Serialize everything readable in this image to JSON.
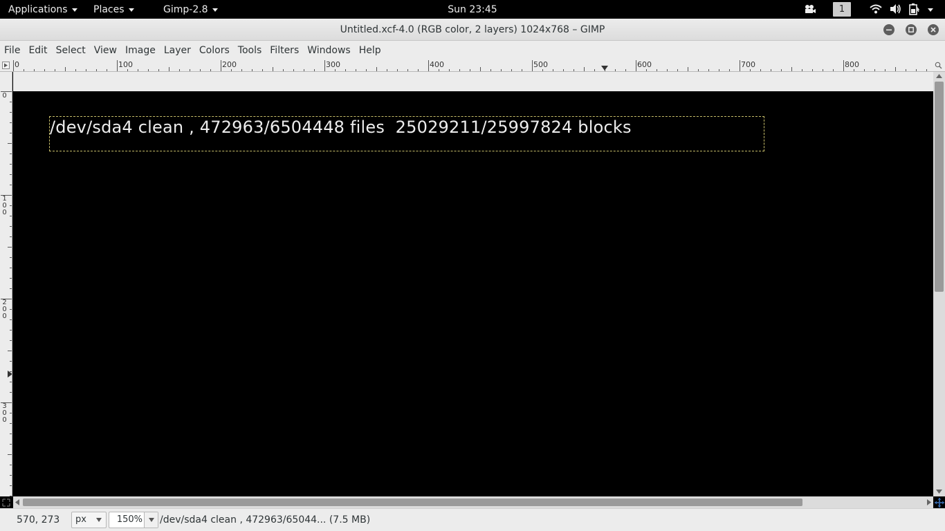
{
  "topbar": {
    "applications": "Applications",
    "places": "Places",
    "app_menu": "Gimp-2.8",
    "clock": "Sun 23:45",
    "workspace": "1"
  },
  "window": {
    "title": "Untitled.xcf-4.0 (RGB color, 2 layers) 1024x768 – GIMP"
  },
  "menubar": {
    "items": [
      "File",
      "Edit",
      "Select",
      "View",
      "Image",
      "Layer",
      "Colors",
      "Tools",
      "Filters",
      "Windows",
      "Help"
    ]
  },
  "rulers": {
    "horizontal": [
      "0",
      "100",
      "200",
      "300",
      "400",
      "500",
      "600",
      "700",
      "800"
    ],
    "vertical": [
      "0",
      "100",
      "200",
      "300"
    ]
  },
  "canvas": {
    "text_layer": "/dev/sda4 clean , 472963/6504448 files  25029211/25997824 blocks"
  },
  "statusbar": {
    "coords": "570, 273",
    "unit": "px",
    "zoom": "150%",
    "message": "/dev/sda4 clean , 472963/65044... (7.5 MB)"
  },
  "scroll": {
    "vertical_position": 0,
    "horizontal_position": 0
  }
}
